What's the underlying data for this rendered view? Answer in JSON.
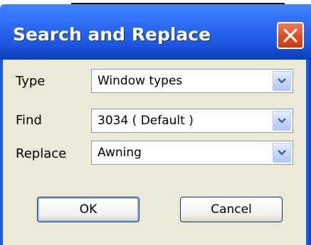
{
  "window": {
    "title": "Search and Replace"
  },
  "form": {
    "type": {
      "label": "Type",
      "value": "Window types"
    },
    "find": {
      "label": "Find",
      "value": "3034 ( Default )"
    },
    "replace": {
      "label": "Replace",
      "value": "Awning"
    }
  },
  "buttons": {
    "ok": "OK",
    "cancel": "Cancel"
  },
  "colors": {
    "titlebar": "#2f6cf2",
    "close": "#de4b22",
    "client": "#ece9d8",
    "field_border": "#7f9db9"
  },
  "icons": {
    "close": "close-icon",
    "dropdown": "chevron-down-icon"
  }
}
